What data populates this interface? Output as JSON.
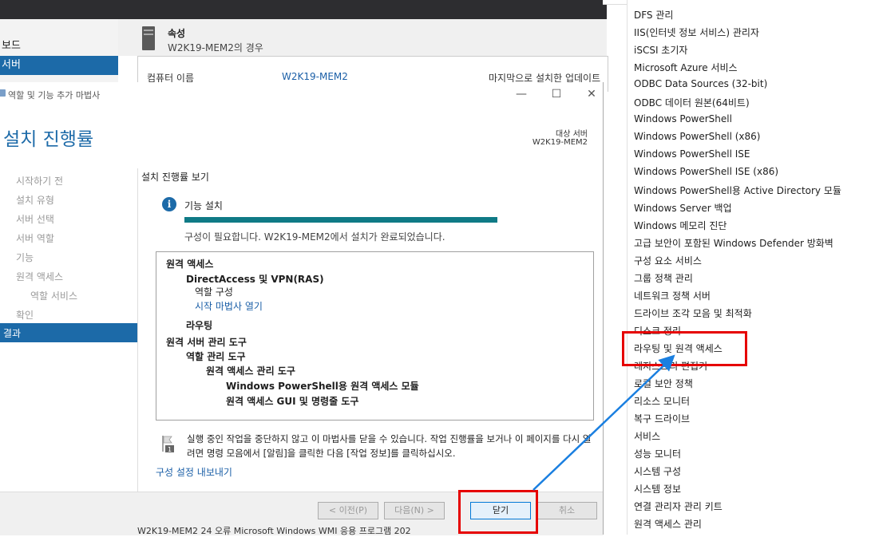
{
  "background": {
    "sidebar_items": [
      "보드",
      "서버"
    ],
    "props_title": "속성",
    "props_sub": "W2K19-MEM2의 경우",
    "prop_label": "컴퓨터 이름",
    "prop_value": "W2K19-MEM2",
    "prop_last": "마지막으로 설치한 업데이트",
    "bottom_row": "W2K19-MEM2    24      오류       Microsoft Windows WMI                    응용 프로그램    202"
  },
  "wizard": {
    "title": "역할 및 기능 추가 마법사",
    "heading": "설치 진행률",
    "dest_label": "대상 서버",
    "dest_server": "W2K19-MEM2",
    "nav": [
      "시작하기 전",
      "설치 유형",
      "서버 선택",
      "서버 역할",
      "기능",
      "원격 액세스",
      "역할 서비스",
      "확인",
      "결과"
    ],
    "view_label": "설치 진행률 보기",
    "feature_install": "기능 설치",
    "progress": 1.0,
    "progress_msg": "구성이 필요합니다. W2K19-MEM2에서 설치가 완료되었습니다.",
    "results": [
      {
        "text": "원격 액세스",
        "style": "b",
        "level": 0
      },
      {
        "text": "DirectAccess 및 VPN(RAS)",
        "style": "b",
        "level": 1
      },
      {
        "text": "역할 구성",
        "style": "n",
        "level": 2
      },
      {
        "text": "시작 마법사 열기",
        "style": "link",
        "level": 2
      },
      {
        "text": "라우팅",
        "style": "b",
        "level": 1
      },
      {
        "text": "원격 서버 관리 도구",
        "style": "b",
        "level": 0
      },
      {
        "text": "역할 관리 도구",
        "style": "b",
        "level": 1
      },
      {
        "text": "원격 액세스 관리 도구",
        "style": "b",
        "level": 2
      },
      {
        "text": "Windows PowerShell용 원격 액세스 모듈",
        "style": "b",
        "level": 3
      },
      {
        "text": "원격 액세스 GUI 및 명령줄 도구",
        "style": "b",
        "level": 3
      }
    ],
    "note": "실행 중인 작업을 중단하지 않고 이 마법사를 닫을 수 있습니다. 작업 진행률을 보거나 이 페이지를 다시 열려면 명령 모음에서 [알림]을 클릭한 다음 [작업 정보]를 클릭하십시오.",
    "export_link": "구성 설정 내보내기",
    "buttons": {
      "prev": "< 이전(P)",
      "next": "다음(N) >",
      "close": "닫기",
      "cancel": "취소"
    }
  },
  "menu": {
    "items": [
      "DFS 관리",
      "IIS(인터넷 정보 서비스) 관리자",
      "iSCSI 초기자",
      "Microsoft Azure 서비스",
      "ODBC Data Sources (32-bit)",
      "ODBC 데이터 원본(64비트)",
      "Windows PowerShell",
      "Windows PowerShell (x86)",
      "Windows PowerShell ISE",
      "Windows PowerShell ISE (x86)",
      "Windows PowerShell용 Active Directory 모듈",
      "Windows Server 백업",
      "Windows 메모리 진단",
      "고급 보안이 포함된 Windows Defender 방화벽",
      "구성 요소 서비스",
      "그룹 정책 관리",
      "네트워크 정책 서버",
      "드라이브 조각 모음 및 최적화",
      "디스크 정리",
      "라우팅 및 원격 액세스",
      "레지스트리 편집기",
      "로컬 보안 정책",
      "리소스 모니터",
      "복구 드라이브",
      "서비스",
      "성능 모니터",
      "시스템 구성",
      "시스템 정보",
      "연결 관리자 관리 키트",
      "원격 액세스 관리"
    ]
  },
  "colors": {
    "accent": "#1c6aa8",
    "highlight": "#e60000",
    "arrow": "#1a7fe0",
    "progress": "#0f7a86"
  }
}
